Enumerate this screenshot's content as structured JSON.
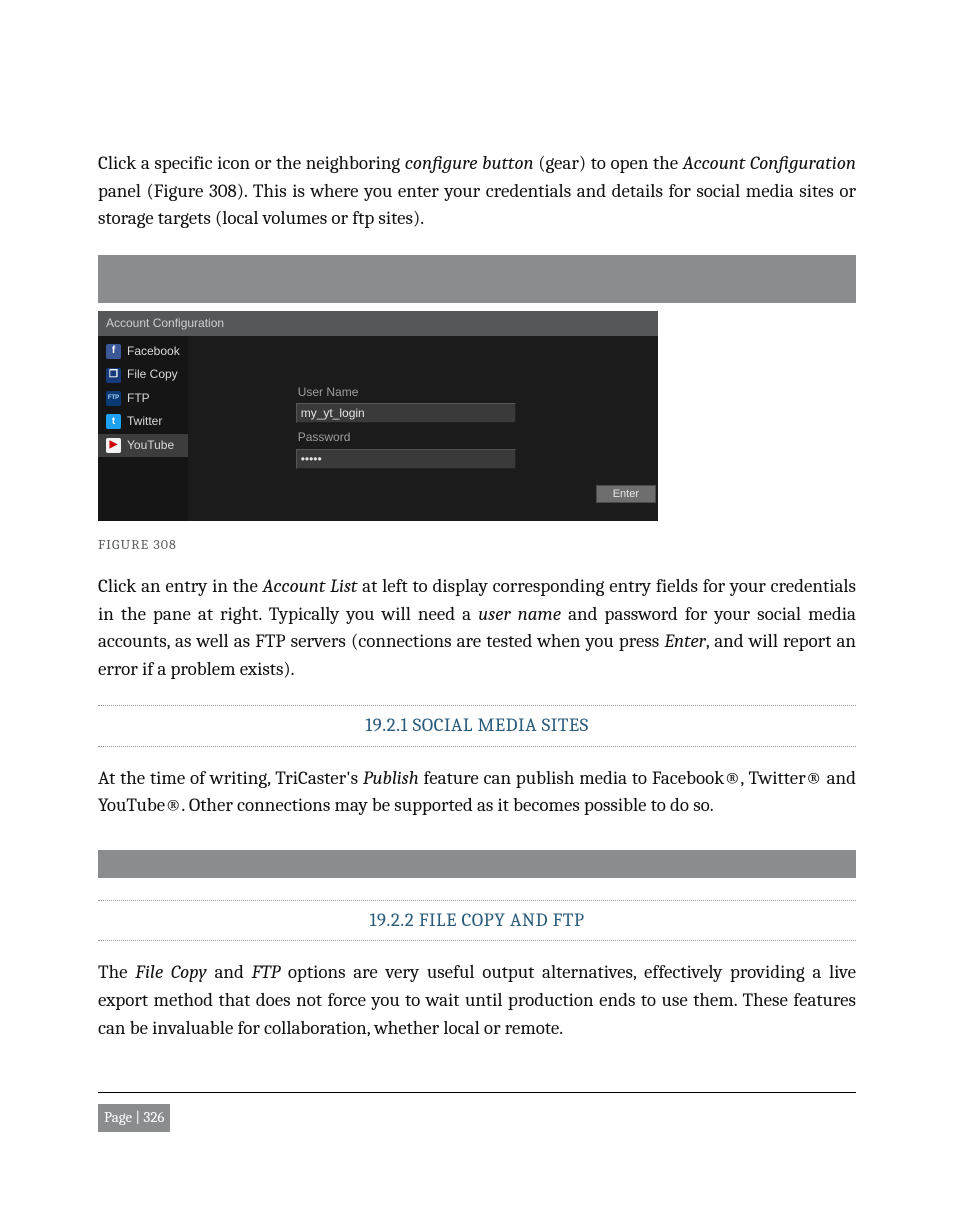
{
  "para1_a": "Click a specific icon or the neighboring ",
  "para1_b": "configure button",
  "para1_c": " (gear) to open the ",
  "para1_d": "Account Configuration",
  "para1_e": " panel (Figure 308).  This is where you enter your credentials and details for social media sites or storage targets (local volumes or ftp sites).",
  "screenshot": {
    "title": "Account Configuration",
    "items": [
      {
        "label": "Facebook",
        "icon_text": "f",
        "bg": "#3b5998",
        "fg": "#fff",
        "name": "facebook-icon"
      },
      {
        "label": "File Copy",
        "icon_text": "❐",
        "bg": "#163a7a",
        "fg": "#fff",
        "name": "file-copy-icon"
      },
      {
        "label": "FTP",
        "icon_text": "FTP",
        "bg": "#0a3a74",
        "fg": "#a6d3ff",
        "name": "ftp-icon"
      },
      {
        "label": "Twitter",
        "icon_text": "t",
        "bg": "#1da1f2",
        "fg": "#fff",
        "name": "twitter-icon"
      },
      {
        "label": "YouTube",
        "icon_text": "▶",
        "bg": "#f2f2f2",
        "fg": "#cc0000",
        "name": "youtube-icon"
      }
    ],
    "username_label": "User Name",
    "username_value": "my_yt_login",
    "password_label": "Password",
    "password_value": "•••••",
    "enter_button": "Enter"
  },
  "figure_caption": "FIGURE 308",
  "para2_a": "Click an entry in the ",
  "para2_b": "Account List",
  "para2_c": " at left to display corresponding entry fields for your credentials in the pane at right.  Typically you will need a ",
  "para2_d": "user name",
  "para2_e": " and password for your social media accounts, as well as FTP servers (connections are tested when you press ",
  "para2_f": "Enter",
  "para2_g": ", and will report an error if a problem exists).",
  "heading1": "19.2.1 SOCIAL MEDIA SITES",
  "para3_a": "At the time of writing, TriCaster's ",
  "para3_b": "Publish",
  "para3_c": " feature can publish media to Facebook®, Twitter® and YouTube®.  Other connections may be supported as it becomes possible to do so.",
  "heading2": "19.2.2 FILE COPY AND FTP",
  "para4_a": "The ",
  "para4_b": "File Copy",
  "para4_c": " and ",
  "para4_d": "FTP",
  "para4_e": " options are very useful output alternatives, effectively providing a live export method that does not force you to wait until production ends to use them.  These features can be invaluable for collaboration, whether local or remote.",
  "page_number": "Page | 326"
}
